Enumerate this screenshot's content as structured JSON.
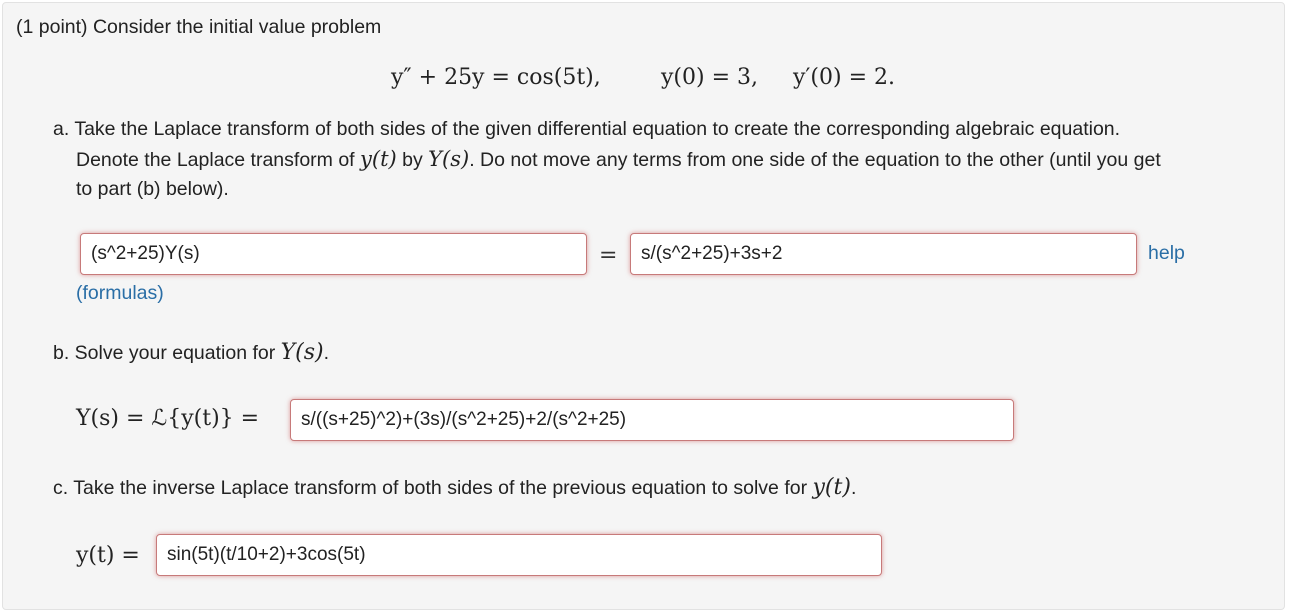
{
  "header": {
    "points": "(1 point)",
    "intro": "Consider the initial value problem"
  },
  "ivp": {
    "equation": "y″ + 25y = cos(5t),",
    "ic1": "y(0) = 3,",
    "ic2": "y′(0) = 2."
  },
  "part_a": {
    "line1": "a. Take the Laplace transform of both sides of the given differential equation to create the corresponding algebraic equation.",
    "line2_prefix": "Denote the Laplace transform of",
    "line2_yt": "y(t)",
    "line2_by": "by",
    "line2_Ys": "Y(s)",
    "line2_suffix": ". Do not move any terms from one side of the equation to the other (until you get",
    "line3": "to part (b) below).",
    "lhs_value": "(s^2+25)Y(s)",
    "equals": "=",
    "rhs_value": "s/(s^2+25)+3s+2",
    "help_link": "help",
    "formulas_link": "(formulas)"
  },
  "part_b": {
    "prompt_prefix": "b. Solve your equation for",
    "prompt_Ys": "Y(s)",
    "prompt_suffix": ".",
    "label": "Y(s) = ℒ{y(t)} =",
    "answer_value": "s/((s+25)^2)+(3s)/(s^2+25)+2/(s^2+25)"
  },
  "part_c": {
    "prompt_prefix": "c. Take the inverse Laplace transform of both sides of the previous equation to solve for",
    "prompt_yt": "y(t)",
    "prompt_suffix": ".",
    "label": "y(t) =",
    "answer_value": "sin(5t)(t/10+2)+3cos(5t)"
  },
  "colors": {
    "link": "#2a6ea6",
    "input_border": "#c77a7a",
    "panel_bg": "#f5f5f5"
  }
}
